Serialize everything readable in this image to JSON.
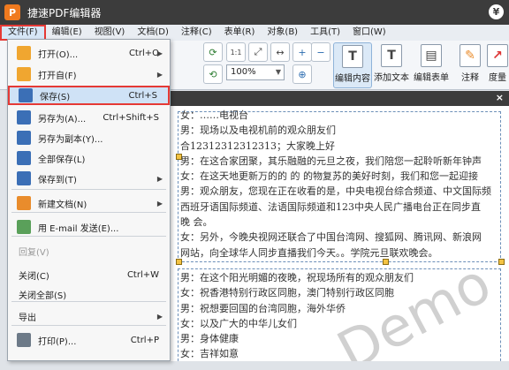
{
  "app": {
    "title": "捷速PDF编辑器",
    "icon_letter": "P",
    "user_symbol": "¥"
  },
  "menubar": [
    "文件(F)",
    "编辑(E)",
    "视图(V)",
    "文档(D)",
    "注释(C)",
    "表单(R)",
    "对象(B)",
    "工具(T)",
    "窗口(W)"
  ],
  "toolbar": {
    "zoom_value": "100%",
    "big_buttons": [
      "编辑内容",
      "添加文本",
      "编辑表单",
      "注释",
      "度量"
    ]
  },
  "file_menu": [
    {
      "label": "打开(O)...",
      "shortcut": "Ctrl+O",
      "arrow": true,
      "icon": "folder-open-icon",
      "color": "#f0a630"
    },
    {
      "label": "打开自(F)",
      "shortcut": "",
      "arrow": true,
      "icon": "folder-icon",
      "color": "#f0a630"
    },
    {
      "label": "保存(S)",
      "shortcut": "Ctrl+S",
      "arrow": false,
      "icon": "save-icon",
      "color": "#3b6fb6",
      "highlight": true
    },
    {
      "label": "另存为(A)...",
      "shortcut": "Ctrl+Shift+S",
      "arrow": false,
      "icon": "save-as-icon",
      "color": "#3b6fb6"
    },
    {
      "label": "另存为副本(Y)...",
      "shortcut": "",
      "arrow": false,
      "icon": "save-copy-icon",
      "color": "#3b6fb6"
    },
    {
      "label": "全部保存(L)",
      "shortcut": "",
      "arrow": false,
      "icon": "save-all-icon",
      "color": "#3b6fb6"
    },
    {
      "label": "保存到(T)",
      "shortcut": "",
      "arrow": true,
      "icon": "save-to-icon",
      "color": "#3b6fb6"
    },
    {
      "label": "新建文档(N)",
      "shortcut": "",
      "arrow": true,
      "icon": "new-document-icon",
      "color": "#e98c2c"
    },
    {
      "label": "用 E-mail 发送(E)...",
      "shortcut": "",
      "arrow": false,
      "icon": "email-icon",
      "color": "#5aa05a"
    },
    {
      "label": "回复(V)",
      "shortcut": "",
      "arrow": false,
      "plain": true,
      "disabled": true
    },
    {
      "label": "关闭(C)",
      "shortcut": "Ctrl+W",
      "arrow": false,
      "plain": true
    },
    {
      "label": "关闭全部(S)",
      "shortcut": "",
      "arrow": false,
      "plain": true
    },
    {
      "label": "导出",
      "shortcut": "",
      "arrow": true,
      "plain": true
    },
    {
      "label": "打印(P)...",
      "shortcut": "Ctrl+P",
      "arrow": false,
      "icon": "printer-icon",
      "color": "#6d7a88"
    },
    {
      "label": "",
      "shortcut": "",
      "arrow": false,
      "plain": true,
      "partial": true
    }
  ],
  "document": {
    "block1": [
      "女：……电视台",
      "男：现场以及电视机前的观众朋友们",
      "合12312312312313；大家晚上好",
      "男：在这合家团聚，其乐融融的元旦之夜，我们陪您一起聆听新年钟声",
      "女：在这天地更新万的的 的 的物复苏的美好时刻，我们和您一起迎接",
      "男：观众朋友，您现在正在收看的是，中央电视台综合频道、中文国际频",
      "西班牙语国际频道、法语国际频道和123中央人民广播电台正在同步直",
      "晚 会。",
      "女：另外，今晚央视网还联合了中国台湾网、搜狐网、腾讯网、新浪网",
      "网站，向全球华人同步直播我们今天。。学院元旦联欢晚会。"
    ],
    "block2": [
      "男：在这个阳光明媚的夜晚，祝现场所有的观众朋友们",
      "女：祝香港特别行政区同胞，澳门特别行政区同胞",
      "男：祝想要回国的台湾同胞，海外华侨",
      "女：以及广大的中华儿女们",
      "男：身体健康",
      "女：吉祥如意"
    ],
    "watermark": "Demo"
  }
}
